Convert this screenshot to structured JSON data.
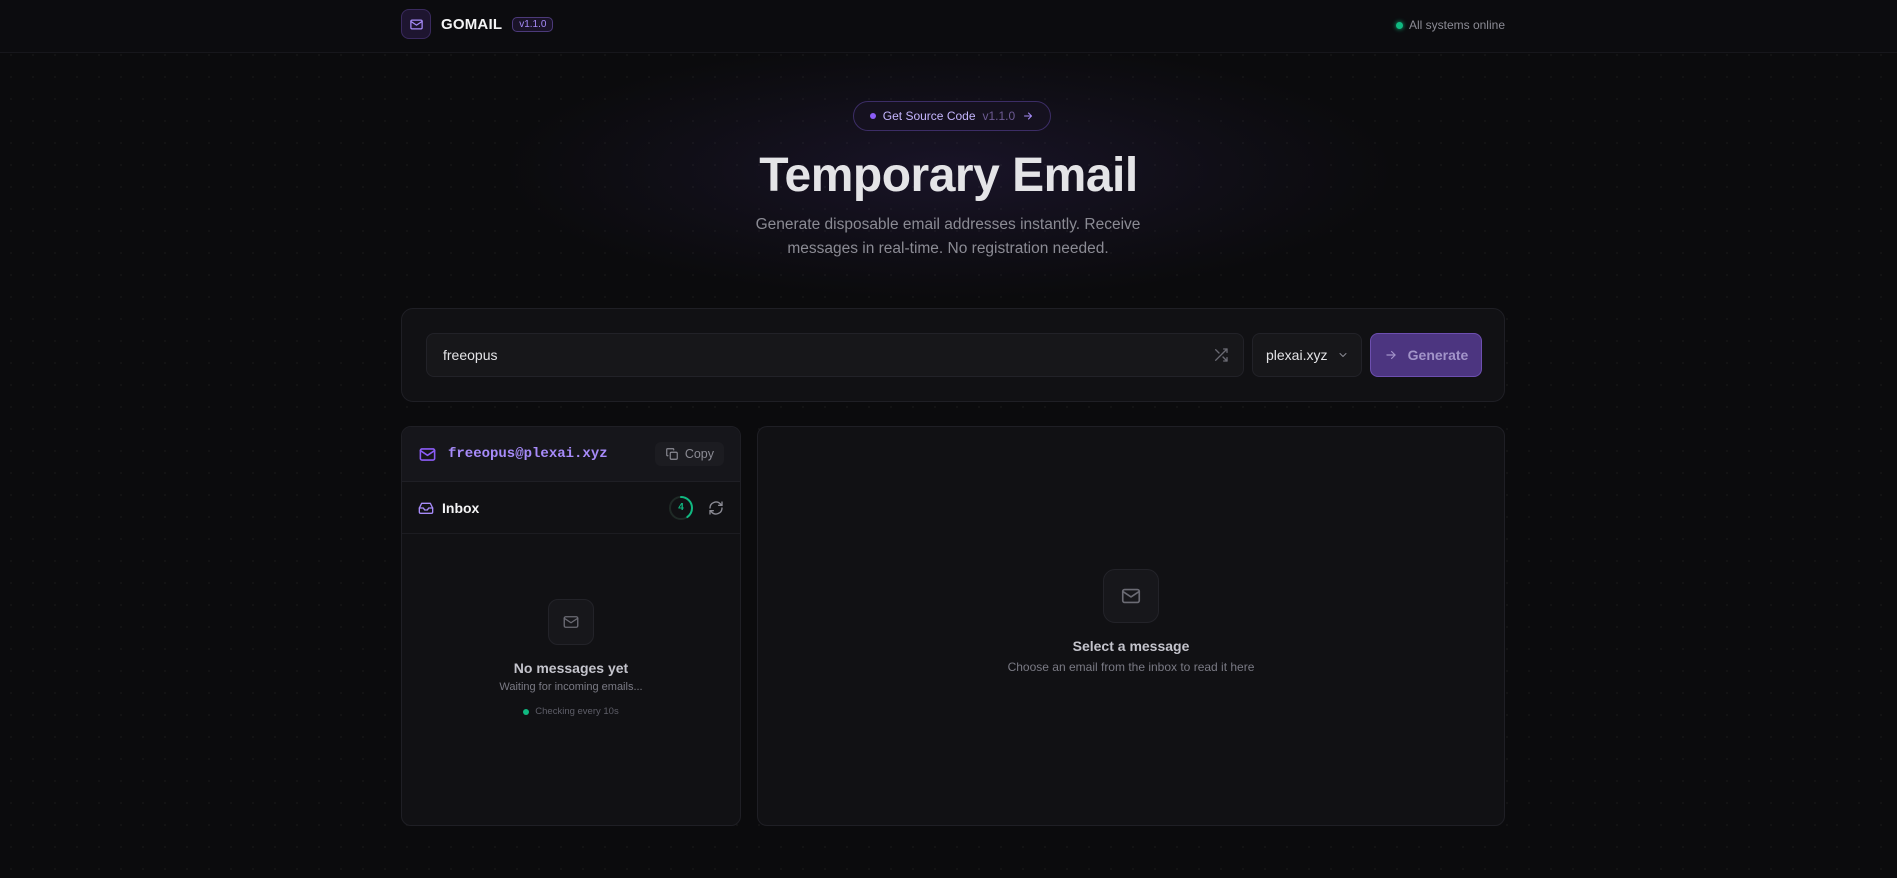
{
  "header": {
    "brand_name": "GOMAIL",
    "brand_version": "v1.1.0",
    "status_text": "All systems online"
  },
  "hero": {
    "pill_label": "Get Source Code",
    "pill_version": "v1.1.0",
    "title": "Temporary Email",
    "subtitle": "Generate disposable email addresses instantly. Receive messages in real-time. No registration needed."
  },
  "generator": {
    "username_value": "freeopus",
    "domain_selected": "plexai.xyz",
    "generate_label": "Generate"
  },
  "inbox": {
    "address": "freeopus@plexai.xyz",
    "copy_label": "Copy",
    "title": "Inbox",
    "countdown_value": "4",
    "countdown_fraction": 0.4,
    "empty_title": "No messages yet",
    "empty_subtitle": "Waiting for incoming emails...",
    "checking_text": "Checking every 10s"
  },
  "reader": {
    "empty_title": "Select a message",
    "empty_subtitle": "Choose an email from the inbox to read it here"
  },
  "colors": {
    "accent": "#8b5cf6",
    "accent_light": "#a78bfa",
    "status_green": "#10b981",
    "background": "#0b0b0d"
  },
  "icons": {
    "brand": "mail-icon",
    "shuffle": "shuffle-icon",
    "chevron": "chevron-down-icon",
    "generate": "arrow-right-icon",
    "copy": "copy-icon",
    "inbox": "inbox-icon",
    "refresh": "refresh-icon"
  }
}
